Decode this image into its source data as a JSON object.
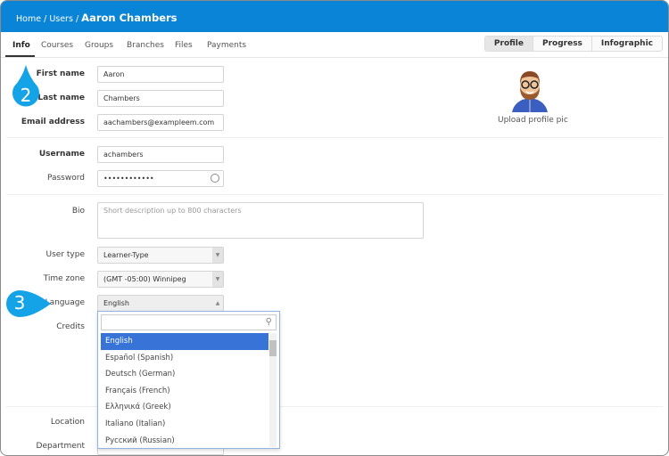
{
  "breadcrumb": {
    "home": "Home",
    "users": "Users",
    "current": "Aaron Chambers"
  },
  "tabs": [
    "Info",
    "Courses",
    "Groups",
    "Branches",
    "Files",
    "Payments"
  ],
  "view_tabs": [
    "Profile",
    "Progress",
    "Infographic"
  ],
  "form": {
    "first_name_label": "First name",
    "first_name": "Aaron",
    "last_name_label": "Last name",
    "last_name": "Chambers",
    "email_label": "Email address",
    "email": "aachambers@exampleem.com",
    "username_label": "Username",
    "username": "achambers",
    "password_label": "Password",
    "password": "••••••••••••",
    "bio_label": "Bio",
    "bio_placeholder": "Short description up to 800 characters",
    "user_type_label": "User type",
    "user_type": "Learner-Type",
    "time_zone_label": "Time zone",
    "time_zone": "(GMT -05:00) Winnipeg",
    "language_label": "Language",
    "language": "English",
    "credits_label": "Credits",
    "location_label": "Location",
    "department_label": "Department"
  },
  "profile": {
    "upload_label": "Upload profile pic"
  },
  "language_options": [
    "English",
    "Español (Spanish)",
    "Deutsch (German)",
    "Français (French)",
    "Ελληνικά (Greek)",
    "Italiano (Italian)",
    "Русский (Russian)"
  ],
  "badges": {
    "step2": "2",
    "step3": "3"
  },
  "colors": {
    "header": "#0a84d6",
    "selected": "#3874d8",
    "badge": "#14a3e6"
  }
}
